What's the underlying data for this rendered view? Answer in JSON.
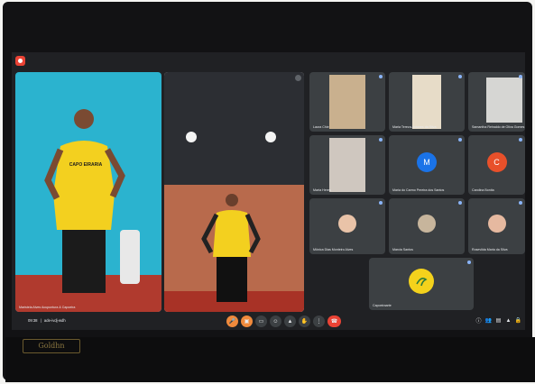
{
  "app": {
    "recording": "record-icon"
  },
  "featured": [
    {
      "name": "Maristela Alves Acupuntura & Capoeira",
      "shirt": "CAPO EIRARIA"
    },
    {
      "name": ""
    }
  ],
  "grid": [
    {
      "name": "Laura Chie"
    },
    {
      "name": "Maria Tereza Antunes da Silva"
    },
    {
      "name": "Samantha Reinaldo de Oliva Gomes"
    },
    {
      "name": "Marta Heres"
    },
    {
      "name": "Maria do Carmo Pereira dos Santos",
      "initial": "M",
      "color": "#1a73e8"
    },
    {
      "name": "Carolina Bonita",
      "initial": "C",
      "color": "#e8502a"
    },
    {
      "name": "Mônica Dias Monteiro Alves"
    },
    {
      "name": "Marcia Santos"
    },
    {
      "name": "Rosevilda Maria da Silva"
    },
    {
      "name": "Capoeiraarte"
    }
  ],
  "footer": {
    "time": "09:38",
    "meet_code": "ade-ivdj-wdh"
  },
  "controls": [
    "mic-icon",
    "camera-icon",
    "captions-icon",
    "emoji-icon",
    "present-icon",
    "raise-hand-icon",
    "more-options-icon"
  ],
  "right_tools": [
    "info-icon",
    "people-icon",
    "chat-icon",
    "activities-icon",
    "lock-icon"
  ],
  "brand": "Goldhn"
}
